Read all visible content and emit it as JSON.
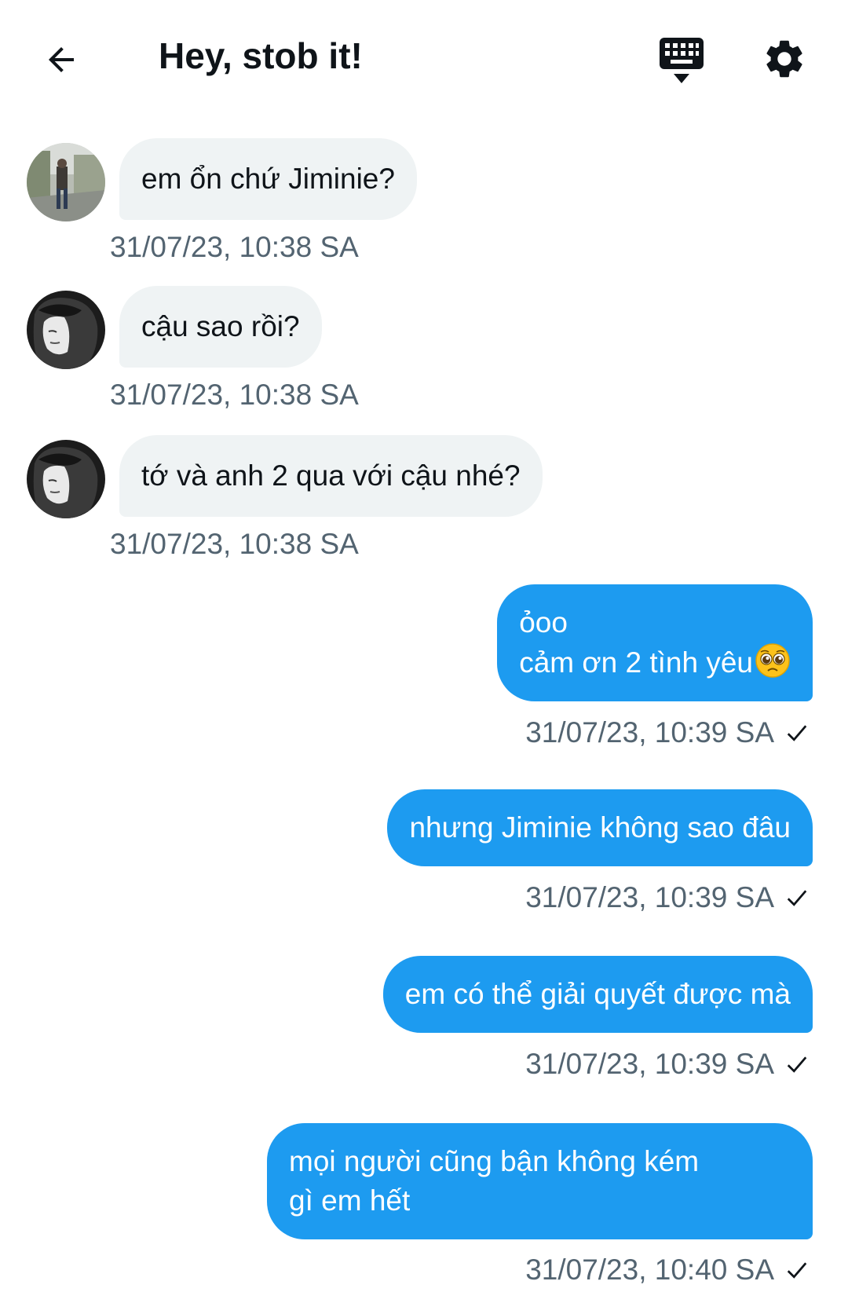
{
  "header": {
    "title": "Hey, stob it!"
  },
  "icons": {
    "back": "arrow-left-icon",
    "keyboard": "keyboard-icon",
    "settings": "gear-icon",
    "read_receipt": "checkmark-icon",
    "emoji": "pleading-face-emoji"
  },
  "colors": {
    "outgoing_bubble": "#1d9bf0",
    "incoming_bubble": "#eff3f4",
    "timestamp": "#536471",
    "text": "#0f1419"
  },
  "messages": [
    {
      "direction": "in",
      "text": "em ổn chứ Jiminie?",
      "time": "31/07/23, 10:38 SA"
    },
    {
      "direction": "in",
      "text": "cậu sao rồi?",
      "time": "31/07/23, 10:38 SA"
    },
    {
      "direction": "in",
      "text": "tớ và anh 2 qua với cậu nhé?",
      "time": "31/07/23, 10:38 SA"
    },
    {
      "direction": "out",
      "lines": [
        "ỏoo",
        "cảm ơn 2 tình yêu"
      ],
      "time": "31/07/23, 10:39 SA"
    },
    {
      "direction": "out",
      "text": "nhưng Jiminie không sao đâu",
      "time": "31/07/23, 10:39 SA"
    },
    {
      "direction": "out",
      "text": "em có thể giải quyết được mà",
      "time": "31/07/23, 10:39 SA"
    },
    {
      "direction": "out",
      "lines": [
        "mọi người cũng bận không kém",
        "gì em hết"
      ],
      "time": "31/07/23, 10:40 SA"
    }
  ]
}
